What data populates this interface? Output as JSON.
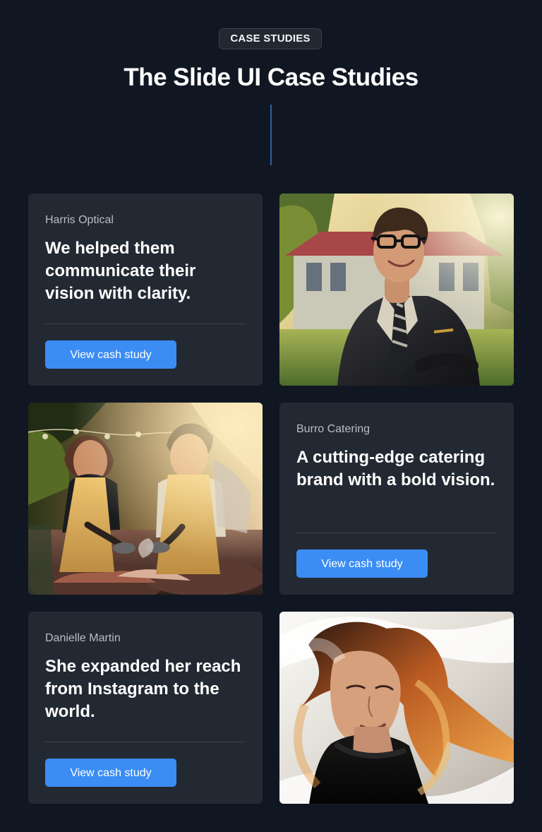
{
  "header": {
    "eyebrow": "CASE STUDIES",
    "title": "The Slide UI Case Studies"
  },
  "cases": [
    {
      "company": "Harris Optical",
      "headline": "We helped them communicate their vision with clarity.",
      "button_label": "View cash study"
    },
    {
      "company": "Burro Catering",
      "headline": "A cutting-edge catering brand with a bold vision.",
      "button_label": "View cash study"
    },
    {
      "company": "Danielle Martin",
      "headline": "She expanded her reach from Instagram to the world.",
      "button_label": "View cash study"
    }
  ],
  "colors": {
    "background": "#111722",
    "card": "#232932",
    "accent": "#3b8df4"
  }
}
